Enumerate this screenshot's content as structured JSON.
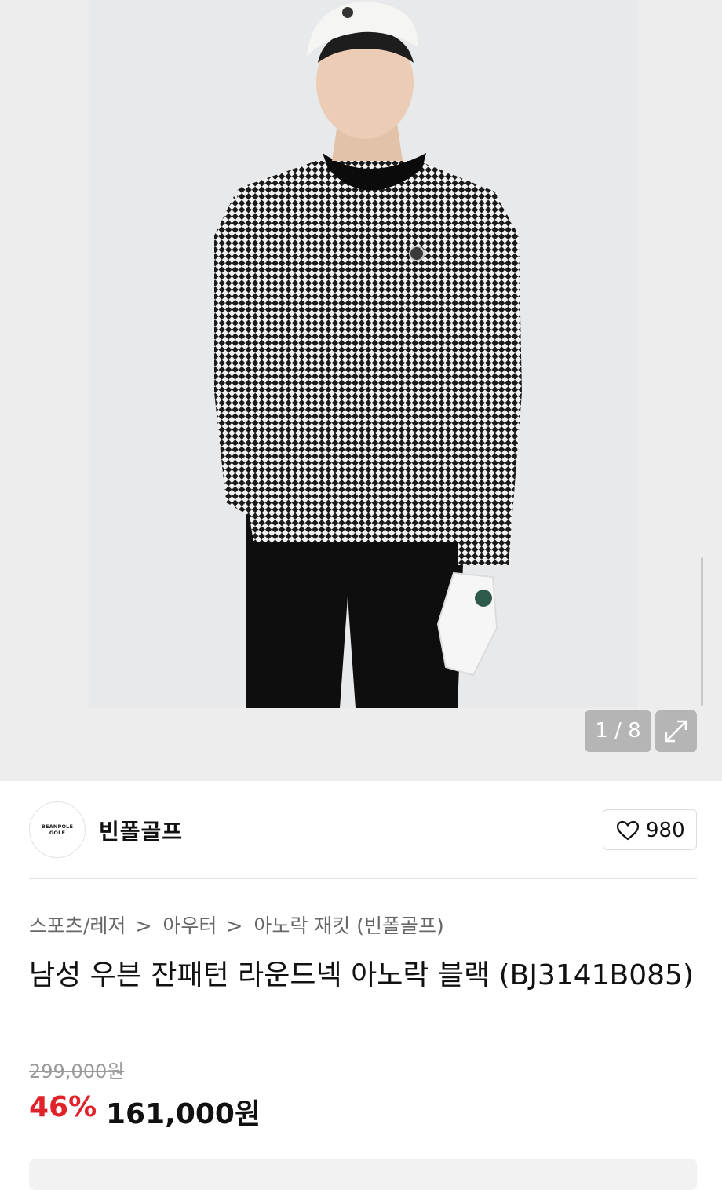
{
  "gallery": {
    "counter": "1 / 8",
    "expand_icon": "expand-arrows-icon",
    "image_alt": "빈폴골프 남성 우븐 잔패턴 라운드넥 아노락 블랙 모델 착용 사진"
  },
  "brand": {
    "logo_text_line1": "BEANPOLE",
    "logo_text_line2": "GOLF",
    "name": "빈폴골프"
  },
  "like": {
    "icon": "heart-icon",
    "count": "980"
  },
  "breadcrumb": {
    "items": [
      "스포츠/레저",
      "아우터",
      "아노락 재킷 (빈폴골프)"
    ],
    "separator": ">"
  },
  "product": {
    "title": "남성 우븐 잔패턴 라운드넥 아노락 블랙 (BJ3141B085)",
    "original_price": "299,000원",
    "discount": "46%",
    "price": "161,000원"
  },
  "colors": {
    "discount": "#e0232b",
    "text": "#111111",
    "muted": "#666666"
  }
}
